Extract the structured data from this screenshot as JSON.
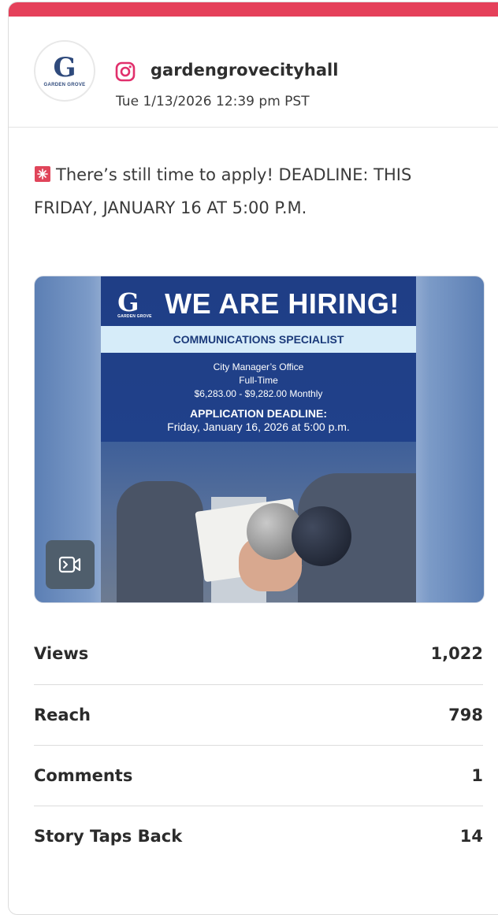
{
  "post": {
    "platform": "instagram",
    "username": "gardengrovecityhall",
    "timestamp": "Tue 1/13/2026 12:39 pm PST",
    "avatar_text": "G",
    "avatar_label": "GARDEN GROVE",
    "caption": "There’s still time to apply! DEADLINE: THIS FRIDAY, JANUARY 16 AT 5:00 P.M.",
    "caption_icon": "rotating-light-icon"
  },
  "media": {
    "type": "video",
    "poster": {
      "logo_text": "G",
      "logo_label": "GARDEN GROVE",
      "title": "WE ARE HIRING!",
      "position": "COMMUNICATIONS SPECIALIST",
      "department": "City Manager’s Office",
      "employment": "Full-Time",
      "salary": "$6,283.00 - $9,282.00 Monthly",
      "deadline_label": "APPLICATION DEADLINE:",
      "deadline": "Friday, January 16, 2026 at 5:00 p.m."
    },
    "badge_icon": "video-camera-icon"
  },
  "stats": [
    {
      "label": "Views",
      "value": "1,022"
    },
    {
      "label": "Reach",
      "value": "798"
    },
    {
      "label": "Comments",
      "value": "1"
    },
    {
      "label": "Story Taps Back",
      "value": "14"
    }
  ],
  "colors": {
    "accent_bar": "#e5405a",
    "instagram": "#e1306c",
    "poster_blue": "#1f3e86",
    "poster_band": "#d6ecf9"
  }
}
